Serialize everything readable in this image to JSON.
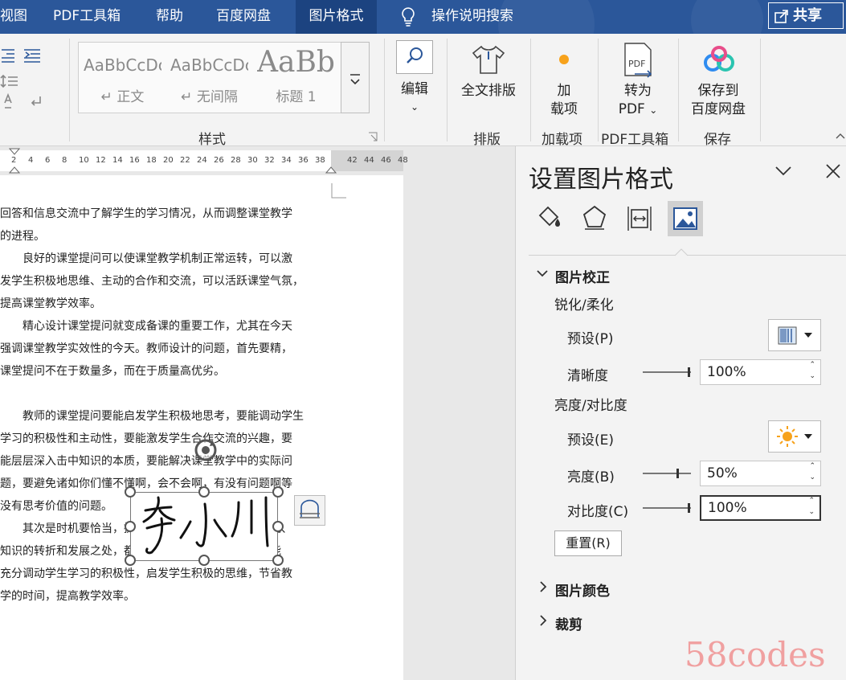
{
  "tabs": {
    "view_partial": "视图",
    "pdf_tools": "PDF工具箱",
    "help": "帮助",
    "baidu_netdisk": "百度网盘",
    "picture_format": "图片格式",
    "search_placeholder": "操作说明搜索"
  },
  "share": {
    "label": "共享"
  },
  "ribbon": {
    "styles": [
      {
        "sample": "AaBbCcDc",
        "name": "↵ 正文"
      },
      {
        "sample": "AaBbCcDc",
        "name": "↵ 无间隔"
      },
      {
        "sample": "AaBb",
        "name": "标题 1"
      }
    ],
    "styles_group": "样式",
    "edit_label": "编辑",
    "full_layout_label": "全文排版",
    "layout_group": "排版",
    "addins_label_1": "加",
    "addins_label_2": "载项",
    "addins_group": "加载项",
    "topdf_label_1": "转为",
    "topdf_label_2": "PDF",
    "pdf_group": "PDF工具箱",
    "save_label_1": "保存到",
    "save_label_2": "百度网盘",
    "save_group": "保存"
  },
  "ruler": {
    "ticks": [
      "2",
      "4",
      "6",
      "8",
      "10",
      "12",
      "14",
      "16",
      "18",
      "20",
      "22",
      "24",
      "26",
      "28",
      "30",
      "32",
      "34",
      "36",
      "38",
      "42",
      "44",
      "46",
      "48"
    ]
  },
  "document": {
    "lines": [
      "回答和信息交流中了解学生的学习情况，从而调整课堂教学",
      "的进程。",
      "　　良好的课堂提问可以使课堂教学机制正常运转，可以激",
      "发学生积极地思维、主动的合作和交流，可以活跃课堂气氛，",
      "提高课堂教学效率。",
      "　　精心设计课堂提问就变成备课的重要工作，尤其在今天",
      "强调课堂教学实效性的今天。教师设计的问题，首先要精，",
      "课堂提问不在于数量多，而在于质量高优劣。",
      "",
      "　　教师的课堂提问要能启发学生积极地思考，要能调动学生",
      "学习的积极性和主动性，要能激发学生合作交流的兴趣，要",
      "能层层深入击中知识的本质，要能解决课堂教学中的实际问",
      "题，要避免诸如你们懂不懂啊，会不会啊，有没有问题啊等",
      "没有思考价值的问题。",
      "　　其次是时机要恰当，提问应选在学生注意力集中之处、",
      "知识的转折和发展之处，都是需要提问的地方，这样才能",
      "充分调动学生学习的积极性，启发学生积极的思维，节省教",
      "学的时间，提高教学效率。"
    ],
    "signature_text": "李小川"
  },
  "pane": {
    "title": "设置图片格式",
    "section_correction": "图片校正",
    "sharpen_heading": "锐化/柔化",
    "preset_label": "预设(P)",
    "sharpness_label": "清晰度",
    "sharpness_value": "100%",
    "brightness_heading": "亮度/对比度",
    "preset2_label": "预设(E)",
    "brightness_label": "亮度(B)",
    "brightness_value": "50%",
    "contrast_label": "对比度(C)",
    "contrast_value": "100%",
    "reset_label": "重置(R)",
    "section_color": "图片颜色",
    "section_crop": "裁剪"
  },
  "watermark": "58codes",
  "colors": {
    "title_bar": "#2b579a",
    "active_tab": "#1c4380",
    "pane_bg": "#f3f3f3",
    "selected_icon_bg": "#d0d0d0",
    "watermark": "#f0a0a0"
  }
}
